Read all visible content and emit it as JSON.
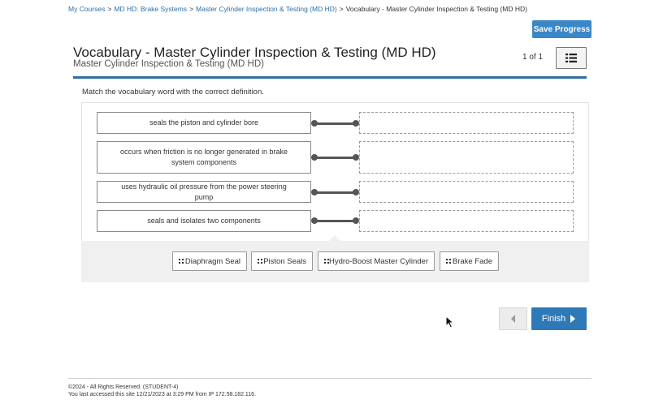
{
  "breadcrumb": {
    "items": [
      "My Courses",
      "MD HD: Brake Systems",
      "Master Cylinder Inspection & Testing (MD HD)"
    ],
    "current": "Vocabulary - Master Cylinder Inspection & Testing (MD HD)",
    "separator": ">"
  },
  "header": {
    "save_label": "Save Progress",
    "title": "Vocabulary - Master Cylinder Inspection & Testing (MD HD)",
    "subtitle": "Master Cylinder Inspection & Testing (MD HD)",
    "page_count": "1 of 1"
  },
  "activity": {
    "instructions": "Match the vocabulary word with the correct definition.",
    "definitions": [
      "seals the piston and cylinder bore",
      "occurs when friction is no longer generated in brake system components",
      "uses hydraulic oil pressure from the power steering pump",
      "seals and isolates two components"
    ],
    "word_bank": [
      "Diaphragm Seal",
      "Piston Seals",
      "Hydro-Boost Master Cylinder",
      "Brake Fade"
    ]
  },
  "nav": {
    "finish_label": "Finish"
  },
  "footer": {
    "copyright": "©2024 - All Rights Reserved. (STUDENT-4)",
    "last_access": "You last accessed this site 12/21/2023 at 3:29 PM from IP 172.58.182.116."
  },
  "colors": {
    "accent": "#3a87c8",
    "title_rule": "#2f6fa5",
    "link": "#2a6fa8"
  },
  "icons": {
    "list_button": "list-icon",
    "prev_button": "chevron-left-icon",
    "finish_button": "caret-right-icon",
    "chip_handle": "drag-handle-icon"
  }
}
